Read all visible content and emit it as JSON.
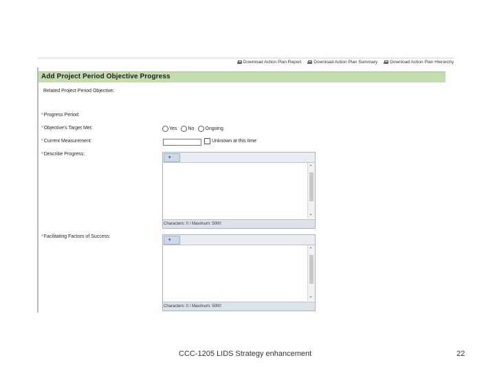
{
  "toolbar": {
    "links": [
      {
        "label": "Download Action Plan Report",
        "icon": "printer-icon"
      },
      {
        "label": "Download Action Plan Summary",
        "icon": "printer-icon"
      },
      {
        "label": "Download Action Plan Hierarchy",
        "icon": "printer-icon"
      }
    ]
  },
  "form": {
    "title": "Add Project Period Objective Progress",
    "related_objective_label": "Related Project Period Objective:",
    "required_marker": "*",
    "progress_period_label": "Progress Period:",
    "target_met_label": "Objective's Target Met:",
    "target_met_options": [
      "Yes",
      "No",
      "Ongoing"
    ],
    "current_measurement_label": "Current Measurement:",
    "current_measurement_value": "",
    "unknown_label": "Unknown at this time",
    "describe_progress_label": "Describe Progress:",
    "facilitating_factors_label": "Facilitating Factors of Success:",
    "editor_counter": "Characters: 0 / Maximum: 5000"
  },
  "slide": {
    "footer": "CCC-1205 LIDS Strategy enhancement",
    "page_number": "22"
  },
  "colors": {
    "header_bar": "#c5dcaf",
    "required_marker": "#c0392b"
  }
}
